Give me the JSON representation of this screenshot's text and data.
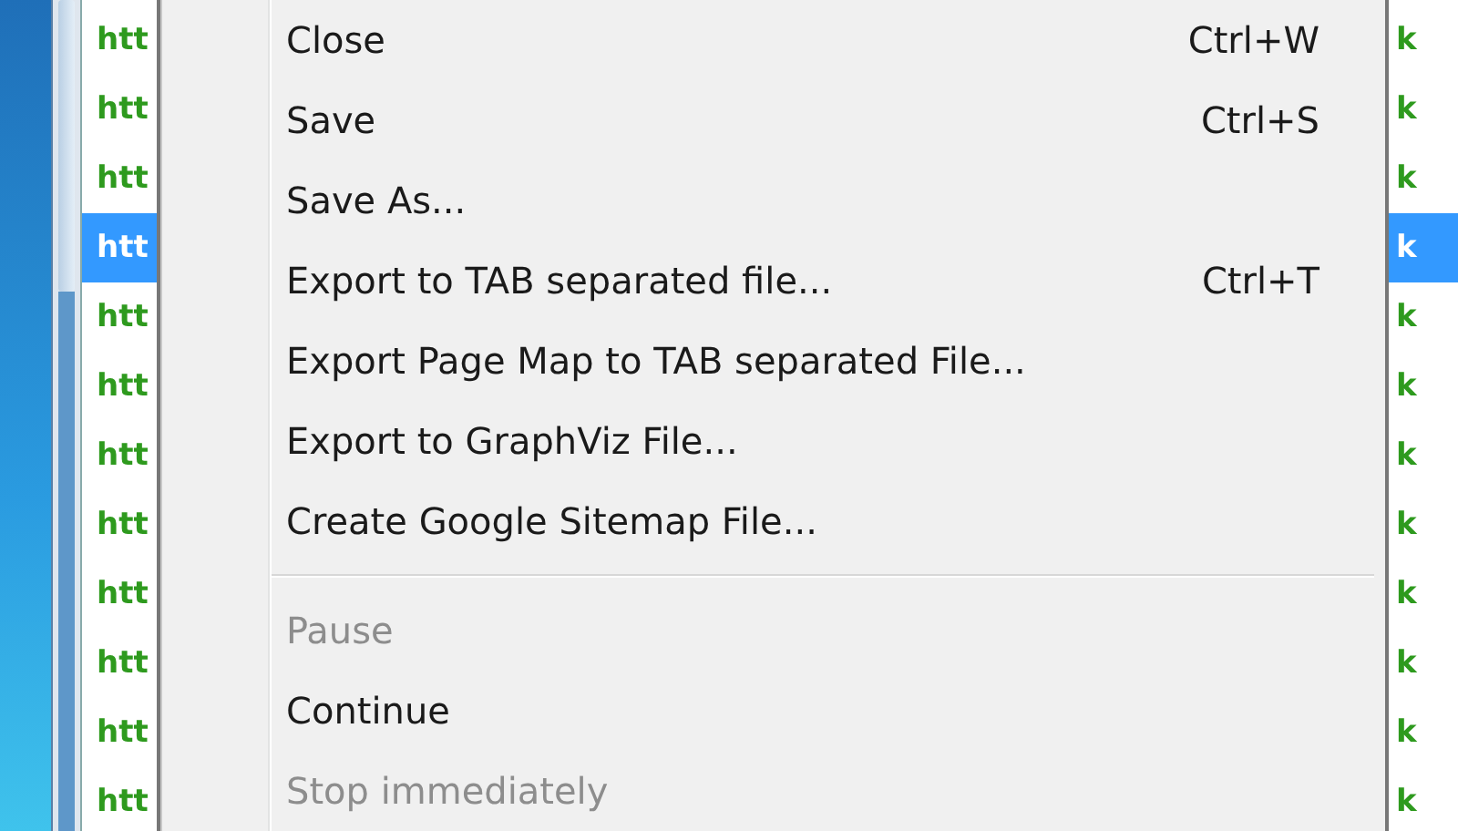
{
  "left_list": {
    "rows": [
      {
        "text": "htt",
        "selected": false
      },
      {
        "text": "htt",
        "selected": false
      },
      {
        "text": "htt",
        "selected": false
      },
      {
        "text": "htt",
        "selected": true
      },
      {
        "text": "htt",
        "selected": false
      },
      {
        "text": "htt",
        "selected": false
      },
      {
        "text": "htt",
        "selected": false
      },
      {
        "text": "htt",
        "selected": false
      },
      {
        "text": "htt",
        "selected": false
      },
      {
        "text": "htt",
        "selected": false
      },
      {
        "text": "htt",
        "selected": false
      },
      {
        "text": "htt",
        "selected": false
      }
    ]
  },
  "menu": {
    "items": [
      {
        "kind": "item",
        "label": "Close",
        "shortcut": "Ctrl+W",
        "disabled": false
      },
      {
        "kind": "item",
        "label": "Save",
        "shortcut": "Ctrl+S",
        "disabled": false
      },
      {
        "kind": "item",
        "label": "Save As...",
        "disabled": false
      },
      {
        "kind": "item",
        "label": "Export to TAB separated file...",
        "shortcut": "Ctrl+T",
        "disabled": false
      },
      {
        "kind": "item",
        "label": "Export Page Map to TAB separated File...",
        "disabled": false
      },
      {
        "kind": "item",
        "label": "Export to GraphViz File...",
        "disabled": false
      },
      {
        "kind": "item",
        "label": "Create Google Sitemap File...",
        "disabled": false
      },
      {
        "kind": "separator"
      },
      {
        "kind": "item",
        "label": "Pause",
        "disabled": true
      },
      {
        "kind": "item",
        "label": "Continue",
        "disabled": false
      },
      {
        "kind": "item",
        "label": "Stop immediately",
        "disabled": true
      }
    ]
  },
  "right_list": {
    "rows": [
      {
        "text": "k",
        "selected": false
      },
      {
        "text": "k",
        "selected": false
      },
      {
        "text": "k",
        "selected": false
      },
      {
        "text": "k",
        "selected": true
      },
      {
        "text": "k",
        "selected": false
      },
      {
        "text": "k",
        "selected": false
      },
      {
        "text": "k",
        "selected": false
      },
      {
        "text": "k",
        "selected": false
      },
      {
        "text": "k",
        "selected": false
      },
      {
        "text": "k",
        "selected": false
      },
      {
        "text": "k",
        "selected": false
      },
      {
        "text": "k",
        "selected": false
      }
    ]
  }
}
